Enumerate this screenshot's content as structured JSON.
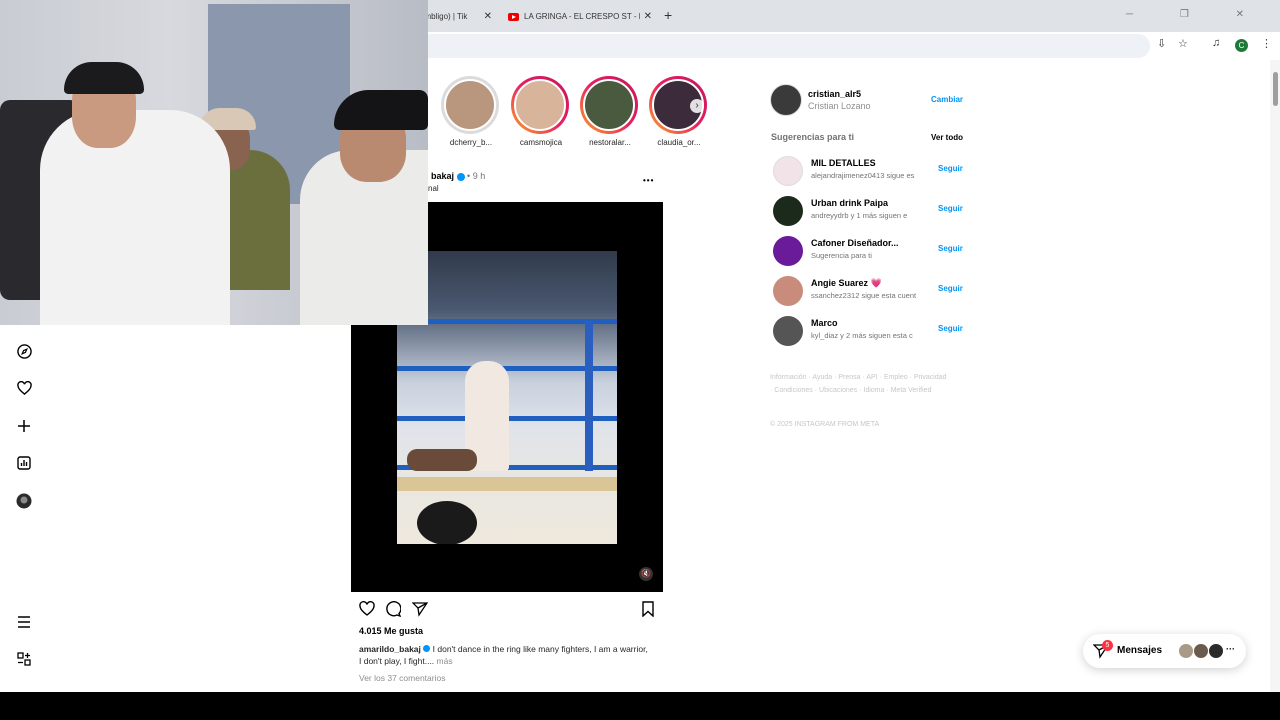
{
  "browser": {
    "tabs": [
      {
        "label": "ombligo) | Tik"
      },
      {
        "label": "LA GRINGA - EL CRESPO ST - F"
      }
    ],
    "new_tab": "+",
    "window_controls": "─ ❐ ✕",
    "profile_initial": "C"
  },
  "nav": {
    "icons": [
      "compass-icon",
      "heart-icon",
      "plus-icon",
      "dashboard-icon",
      "profile-avatar",
      "menu-icon",
      "more-icon"
    ]
  },
  "stories": [
    {
      "user": "dcherry_b...",
      "seen": true
    },
    {
      "user": "camsmojica",
      "seen": false
    },
    {
      "user": "nestoralar...",
      "seen": false
    },
    {
      "user": "claudia_or...",
      "seen": false
    }
  ],
  "post": {
    "username": "bakaj",
    "time": "• 9 h",
    "subtitle": "nal",
    "more": "•••",
    "likes": "4.015 Me gusta",
    "caption_user": "amarildo_bakaj",
    "caption_text": " I don't dance in the ring like many fighters, I am a warrior, I don't play, I fight....",
    "caption_more": " más",
    "comments": "Ver los 37 comentarios"
  },
  "me": {
    "username": "cristian_alr5",
    "name": "Cristian Lozano",
    "switch_label": "Cambiar"
  },
  "suggestions": {
    "title": "Sugerencias para ti",
    "see_all": "Ver todo",
    "follow_label": "Seguir",
    "items": [
      {
        "name": "MIL DETALLES",
        "sub": "alejandrajimenez0413 sigue es",
        "color": "#f1e3e8"
      },
      {
        "name": "Urban drink Paipa",
        "sub": "andreyydrb y 1 más siguen e",
        "color": "#1b2a1a"
      },
      {
        "name": "Cafoner Diseñador...",
        "sub": "Sugerencia para ti",
        "color": "#6a1b9a"
      },
      {
        "name": "Angie Suarez 💗",
        "sub": "ssanchez2312 sigue esta cuent",
        "color": "#c98b7c"
      },
      {
        "name": "Marco",
        "sub": "kyl_diaz y 2 más siguen esta c",
        "color": "#555555"
      }
    ]
  },
  "footer": {
    "links": "Información · Ayuda · Prensa · API · Empleo · Privacidad · Condiciones · Ubicaciones · Idioma · Meta Verified",
    "copyright": "© 2025 INSTAGRAM FROM META"
  },
  "messages": {
    "label": "Mensajes",
    "badge": "5",
    "more": "···"
  },
  "colors": {
    "accent": "#0095f6",
    "story_ring_start": "#f9a825",
    "story_ring_end": "#c2185b",
    "badge": "#ff3040"
  }
}
